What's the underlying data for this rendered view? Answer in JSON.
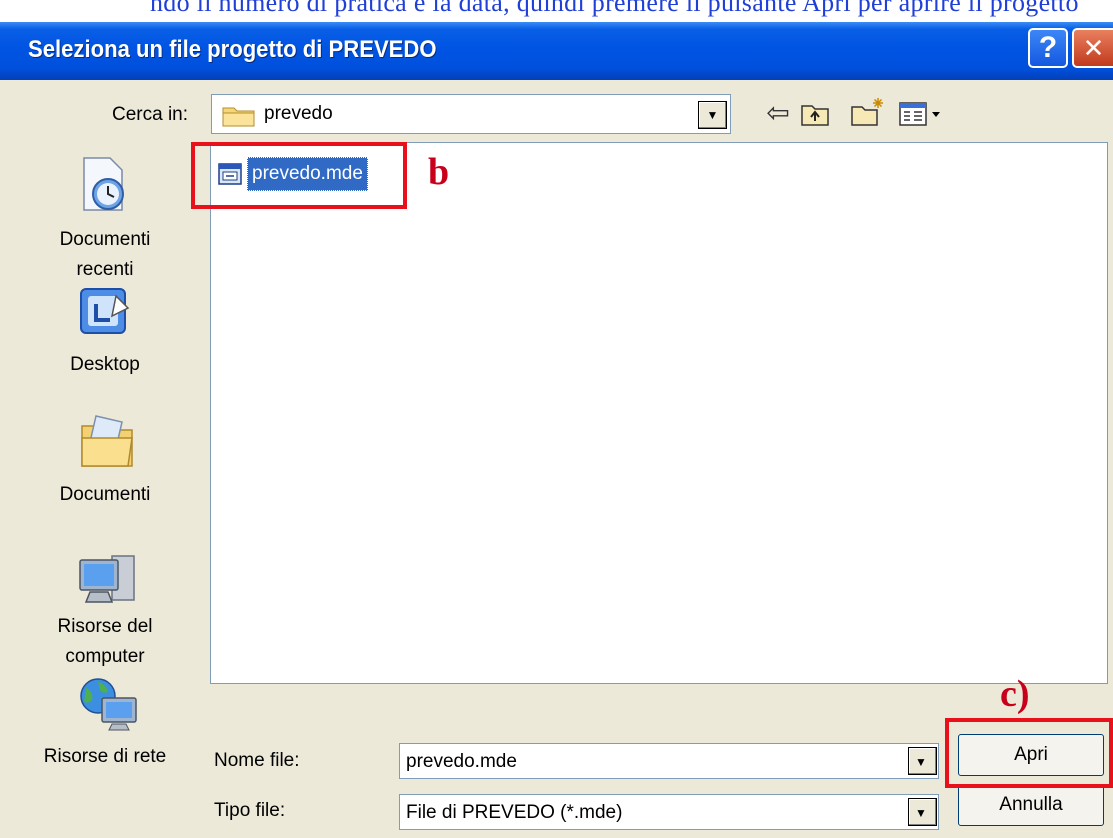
{
  "doc_fragment": "ndo il numero di pratica e la data, quindi premere il pulsante Apri per aprire il progetto",
  "dialog": {
    "title": "Seleziona un file progetto di PREVEDO",
    "help_glyph": "?",
    "close_glyph": "✕"
  },
  "look_in": {
    "label": "Cerca in:",
    "value": "prevedo"
  },
  "toolbar": {
    "back_icon": "back-arrow-icon",
    "up_icon": "up-folder-icon",
    "new_folder_icon": "new-folder-icon",
    "views_icon": "views-menu-icon",
    "arrow_glyph": "▼",
    "back_glyph": "⇦"
  },
  "places": [
    {
      "label": "Documenti recenti",
      "icon": "recent-documents-icon"
    },
    {
      "label": "Desktop",
      "icon": "desktop-icon"
    },
    {
      "label": "Documenti",
      "icon": "my-documents-icon"
    },
    {
      "label": "Risorse del computer",
      "icon": "my-computer-icon"
    },
    {
      "label": "Risorse di rete",
      "icon": "network-places-icon"
    }
  ],
  "files": [
    {
      "name": "prevedo.mde",
      "selected": true,
      "icon": "access-mde-file-icon"
    }
  ],
  "filename": {
    "label": "Nome file:",
    "value": "prevedo.mde"
  },
  "filetype": {
    "label": "Tipo file:",
    "value": "File di PREVEDO (*.mde)"
  },
  "buttons": {
    "open": "Apri",
    "cancel": "Annulla"
  },
  "annotations": {
    "b": "b",
    "c": "c)"
  },
  "colors": {
    "titlebar": "#0054e3",
    "selection": "#316ac5",
    "annotation_red": "#e8101a",
    "dialog_bg": "#ece9d8"
  }
}
